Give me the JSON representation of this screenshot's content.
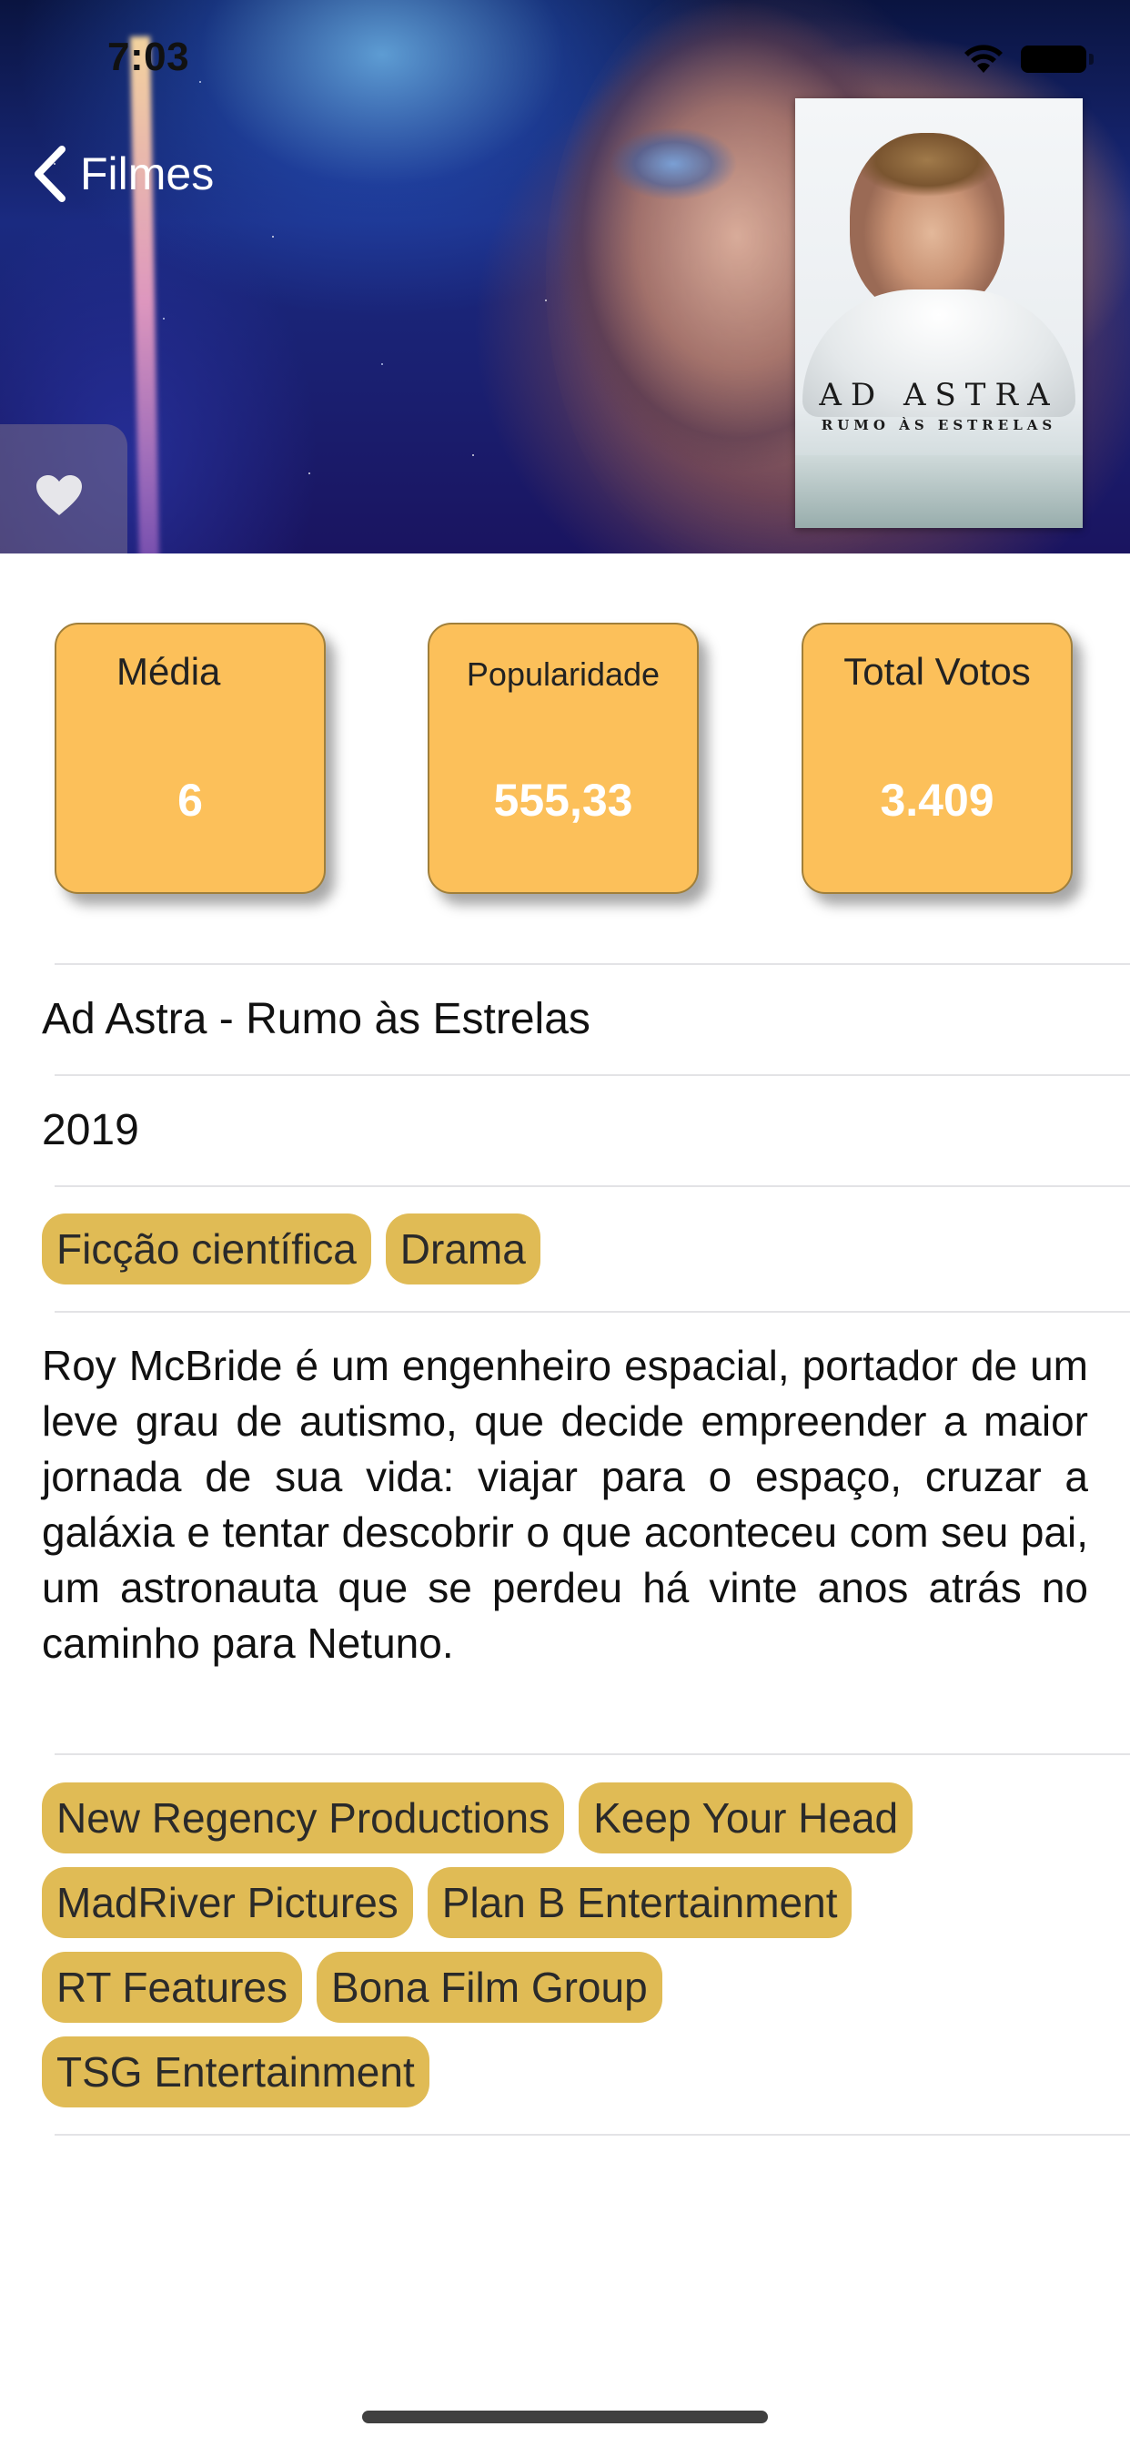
{
  "status_bar": {
    "time": "7:03"
  },
  "nav": {
    "back_label": "Filmes"
  },
  "poster": {
    "title": "AD ASTRA",
    "subtitle": "RUMO ÀS ESTRELAS"
  },
  "stats": [
    {
      "label": "Média",
      "value": "6"
    },
    {
      "label": "Popularidade",
      "value": "555,33"
    },
    {
      "label": "Total Votos",
      "value": "3.409"
    }
  ],
  "movie": {
    "title": "Ad Astra - Rumo às Estrelas",
    "year": "2019",
    "genres": [
      "Ficção científica",
      "Drama"
    ],
    "overview": "Roy McBride é um engenheiro espacial, portador de um leve grau de autismo, que decide empreender a maior jornada de sua vida: viajar para o espaço, cruzar a galáxia e tentar descobrir o que aconteceu com seu pai, um astronauta que se perdeu há vinte anos atrás no caminho para Netuno.",
    "production_companies": [
      "New Regency Productions",
      "Keep Your Head",
      "MadRiver Pictures",
      "Plan B Entertainment",
      "RT Features",
      "Bona Film Group",
      "TSG Entertainment"
    ]
  },
  "colors": {
    "card_fill": "#fcc05a",
    "chip_fill": "#e0bb55",
    "accent_text": "#ffffff"
  },
  "icons": [
    "wifi-icon",
    "battery-icon",
    "chevron-left-icon",
    "heart-icon"
  ]
}
